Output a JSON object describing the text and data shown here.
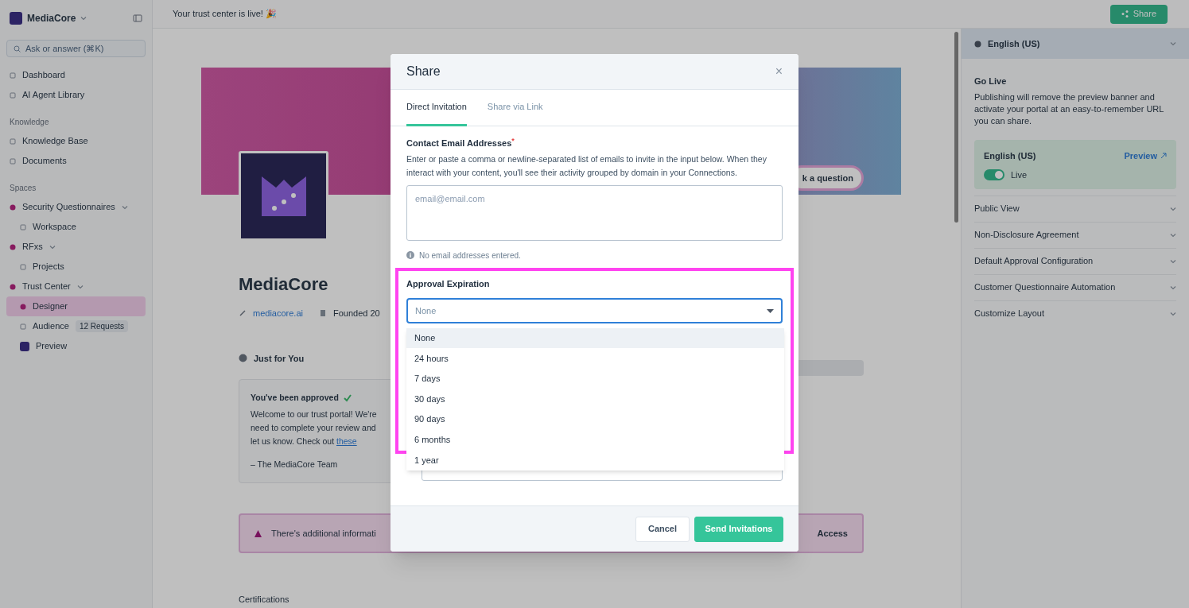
{
  "sidebar": {
    "brand": "MediaCore",
    "search": {
      "placeholder": "Ask or answer (⌘K)"
    },
    "groups": [
      {
        "items": [
          {
            "label": "Dashboard",
            "kind": "plain",
            "selected": false
          },
          {
            "label": "AI Agent Library",
            "kind": "plain",
            "selected": false
          }
        ]
      },
      {
        "title": "Knowledge",
        "items": [
          {
            "label": "Knowledge Base",
            "kind": "plain",
            "selected": false
          },
          {
            "label": "Documents",
            "kind": "plain",
            "selected": false
          }
        ]
      },
      {
        "title": "Spaces",
        "items": [
          {
            "label": "Security Questionnaires",
            "kind": "dot",
            "selected": false,
            "expanded": true,
            "children": [
              {
                "label": "Workspace",
                "kind": "plain",
                "selected": false
              }
            ]
          },
          {
            "label": "RFxs",
            "kind": "dot",
            "selected": false,
            "expanded": true,
            "children": [
              {
                "label": "Projects",
                "kind": "plain",
                "selected": false
              }
            ]
          },
          {
            "label": "Trust Center",
            "kind": "dot",
            "selected": false,
            "expanded": true,
            "children": [
              {
                "label": "Designer",
                "kind": "dot",
                "selected": true
              },
              {
                "label": "Audience",
                "kind": "plain",
                "selected": false,
                "badge": "12 Requests"
              },
              {
                "label": "Preview",
                "kind": "logo",
                "selected": false
              }
            ]
          }
        ]
      }
    ]
  },
  "top_bar": {
    "notice": "Your trust center is live! 🎉",
    "share_button": "Share"
  },
  "profile": {
    "name": "MediaCore",
    "website": "mediacore.ai",
    "founded": "Founded 20",
    "ask_button": "k a question",
    "section": "Just for You",
    "approved_card": {
      "title": "You've been approved",
      "lines": [
        "Welcome to our trust portal! We're",
        "need to complete your review and",
        "let us know. Check out"
      ],
      "link": "these",
      "signature": "– The MediaCore Team"
    },
    "alert": {
      "text": "There's additional informati",
      "action": "Access"
    },
    "certifications": "Certifications"
  },
  "right_panel": {
    "language": "English (US)",
    "go_live": {
      "title": "Go Live",
      "description": "Publishing will remove the preview banner and activate your portal at an easy-to-remember URL you can share."
    },
    "card": {
      "language": "English (US)",
      "preview_link": "Preview",
      "toggle": {
        "label": "Live",
        "on": true
      }
    },
    "accordion": [
      "Public View",
      "Non-Disclosure Agreement",
      "Default Approval Configuration",
      "Customer Questionnaire Automation",
      "Customize Layout"
    ]
  },
  "dialog": {
    "title": "Share",
    "close": "×",
    "tabs": [
      {
        "label": "Direct Invitation",
        "selected": true
      },
      {
        "label": "Share via Link",
        "selected": false
      }
    ],
    "emails": {
      "label": "Contact Email Addresses",
      "required_mark": "*",
      "description": "Enter or paste a comma or newline-separated list of emails to invite in the input below. When they interact with your content, you'll see their activity grouped by domain in your Connections.",
      "placeholder": "email@email.com",
      "hint": "No email addresses entered."
    },
    "approval_expiration": {
      "label": "Approval Expiration",
      "value": "None",
      "focused": true,
      "highlighted": true,
      "expanded": true,
      "options": [
        {
          "label": "None",
          "selected": true
        },
        {
          "label": "24 hours",
          "selected": false
        },
        {
          "label": "7 days",
          "selected": false
        },
        {
          "label": "30 days",
          "selected": false
        },
        {
          "label": "90 days",
          "selected": false
        },
        {
          "label": "6 months",
          "selected": false
        },
        {
          "label": "1 year",
          "selected": false
        }
      ]
    },
    "buttons": [
      {
        "label": "Cancel",
        "kind": "secondary"
      },
      {
        "label": "Send Invitations",
        "kind": "primary"
      }
    ]
  }
}
